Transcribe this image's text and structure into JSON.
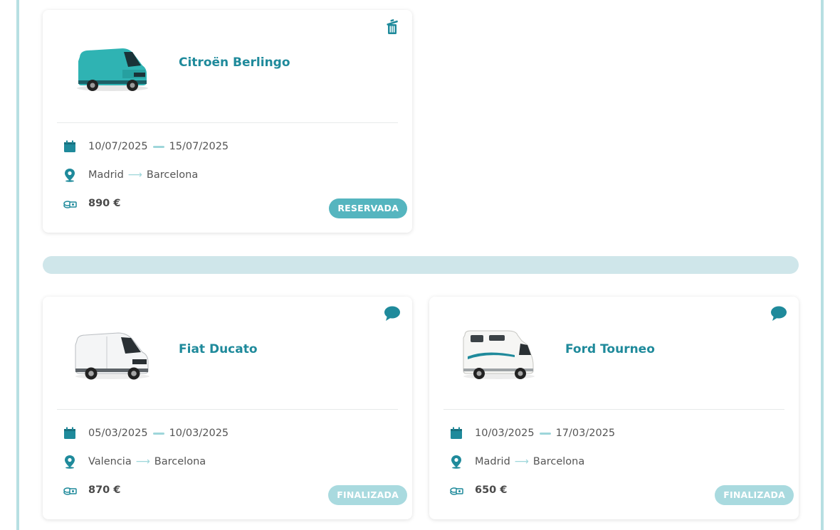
{
  "reservation_card": {
    "vehicle_name": "Citroën Berlingo",
    "date_start": "10/07/2025",
    "date_end": "15/07/2025",
    "origin": "Madrid",
    "destination": "Barcelona",
    "price": "890 €",
    "status": "RESERVADA",
    "action_icon": "trash-icon"
  },
  "past_cards": [
    {
      "vehicle_name": "Fiat Ducato",
      "date_start": "05/03/2025",
      "date_end": "10/03/2025",
      "origin": "Valencia",
      "destination": "Barcelona",
      "price": "870 €",
      "status": "FINALIZADA",
      "action_icon": "chat-icon"
    },
    {
      "vehicle_name": "Ford Tourneo",
      "date_start": "10/03/2025",
      "date_end": "17/03/2025",
      "origin": "Madrid",
      "destination": "Barcelona",
      "price": "650 €",
      "status": "FINALIZADA",
      "action_icon": "chat-icon"
    }
  ],
  "colors": {
    "accent": "#1f8a9b",
    "badge_reserved": "#55b5bf",
    "badge_finished": "#a9dadf",
    "frame": "#b7dfe2"
  }
}
